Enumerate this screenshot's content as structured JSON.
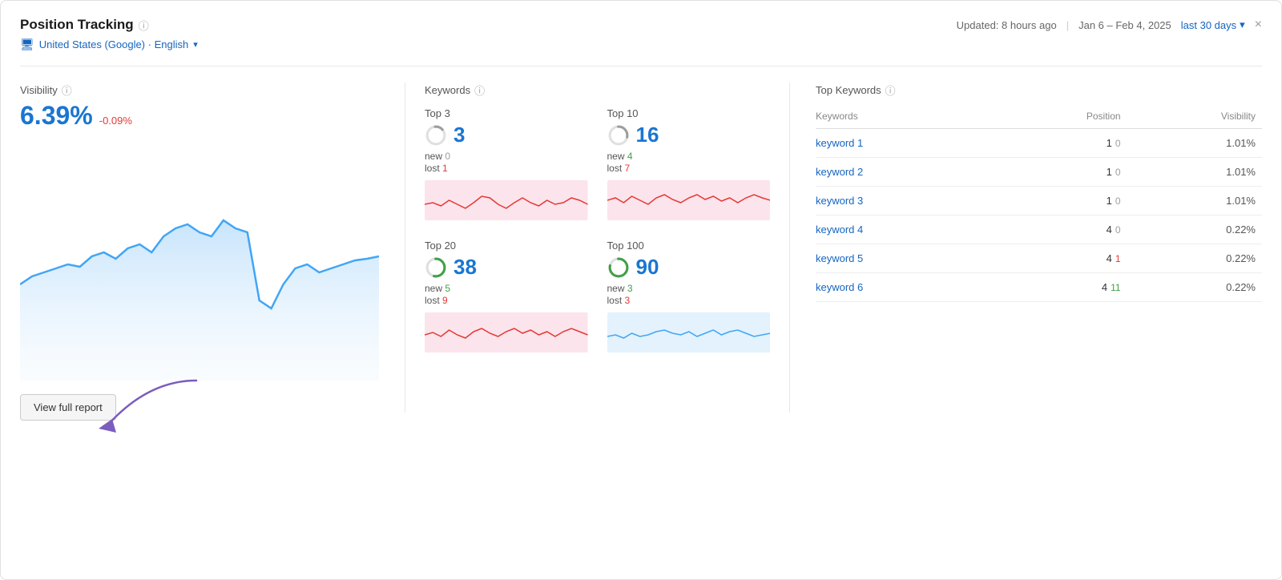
{
  "header": {
    "title": "Position Tracking",
    "updated": "Updated: 8 hours ago",
    "date_range": "Jan 6 – Feb 4, 2025",
    "period_label": "last 30 days",
    "close_label": "×"
  },
  "subheader": {
    "location": "United States (Google) · English"
  },
  "visibility": {
    "label": "Visibility",
    "value": "6.39%",
    "delta": "-0.09%"
  },
  "keywords": {
    "label": "Keywords",
    "cards": [
      {
        "label": "Top 3",
        "count": "3",
        "new_label": "new",
        "new_val": "0",
        "lost_label": "lost",
        "lost_val": "1",
        "lost_color": "red",
        "new_color": "gray",
        "chart_color": "red",
        "donut_pct": 15
      },
      {
        "label": "Top 10",
        "count": "16",
        "new_label": "new",
        "new_val": "4",
        "lost_label": "lost",
        "lost_val": "7",
        "lost_color": "red",
        "new_color": "green",
        "chart_color": "red",
        "donut_pct": 30
      },
      {
        "label": "Top 20",
        "count": "38",
        "new_label": "new",
        "new_val": "5",
        "lost_label": "lost",
        "lost_val": "9",
        "lost_color": "red",
        "new_color": "green",
        "chart_color": "red",
        "donut_pct": 55
      },
      {
        "label": "Top 100",
        "count": "90",
        "new_label": "new",
        "new_val": "3",
        "lost_label": "lost",
        "lost_val": "3",
        "lost_color": "red",
        "new_color": "green",
        "chart_color": "blue",
        "donut_pct": 80
      }
    ]
  },
  "top_keywords": {
    "label": "Top Keywords",
    "col_keywords": "Keywords",
    "col_position": "Position",
    "col_visibility": "Visibility",
    "rows": [
      {
        "keyword": "keyword 1",
        "pos": "1",
        "pos_delta": "0",
        "pos_delta_type": "zero",
        "visibility": "1.01%"
      },
      {
        "keyword": "keyword 2",
        "pos": "1",
        "pos_delta": "0",
        "pos_delta_type": "zero",
        "visibility": "1.01%"
      },
      {
        "keyword": "keyword 3",
        "pos": "1",
        "pos_delta": "0",
        "pos_delta_type": "zero",
        "visibility": "1.01%"
      },
      {
        "keyword": "keyword 4",
        "pos": "4",
        "pos_delta": "0",
        "pos_delta_type": "zero",
        "visibility": "0.22%"
      },
      {
        "keyword": "keyword 5",
        "pos": "4",
        "pos_delta": "1",
        "pos_delta_type": "neg",
        "visibility": "0.22%"
      },
      {
        "keyword": "keyword 6",
        "pos": "4",
        "pos_delta": "11",
        "pos_delta_type": "pos",
        "visibility": "0.22%"
      }
    ]
  },
  "buttons": {
    "view_full_report": "View full report"
  }
}
